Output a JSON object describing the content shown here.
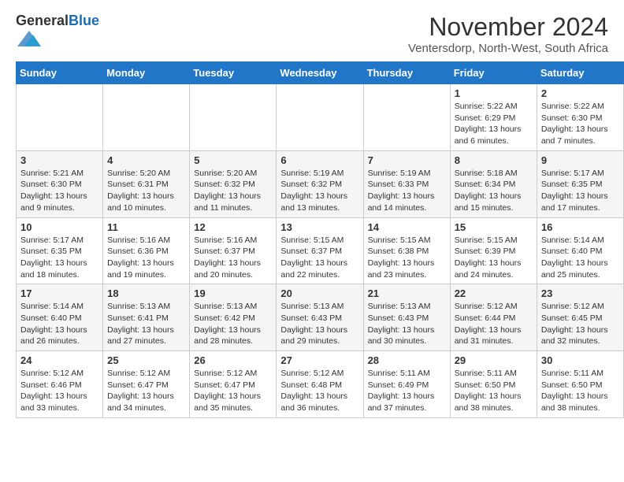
{
  "header": {
    "logo_general": "General",
    "logo_blue": "Blue",
    "title": "November 2024",
    "location": "Ventersdorp, North-West, South Africa"
  },
  "days_of_week": [
    "Sunday",
    "Monday",
    "Tuesday",
    "Wednesday",
    "Thursday",
    "Friday",
    "Saturday"
  ],
  "weeks": [
    [
      {
        "day": "",
        "info": ""
      },
      {
        "day": "",
        "info": ""
      },
      {
        "day": "",
        "info": ""
      },
      {
        "day": "",
        "info": ""
      },
      {
        "day": "",
        "info": ""
      },
      {
        "day": "1",
        "info": "Sunrise: 5:22 AM\nSunset: 6:29 PM\nDaylight: 13 hours and 6 minutes."
      },
      {
        "day": "2",
        "info": "Sunrise: 5:22 AM\nSunset: 6:30 PM\nDaylight: 13 hours and 7 minutes."
      }
    ],
    [
      {
        "day": "3",
        "info": "Sunrise: 5:21 AM\nSunset: 6:30 PM\nDaylight: 13 hours and 9 minutes."
      },
      {
        "day": "4",
        "info": "Sunrise: 5:20 AM\nSunset: 6:31 PM\nDaylight: 13 hours and 10 minutes."
      },
      {
        "day": "5",
        "info": "Sunrise: 5:20 AM\nSunset: 6:32 PM\nDaylight: 13 hours and 11 minutes."
      },
      {
        "day": "6",
        "info": "Sunrise: 5:19 AM\nSunset: 6:32 PM\nDaylight: 13 hours and 13 minutes."
      },
      {
        "day": "7",
        "info": "Sunrise: 5:19 AM\nSunset: 6:33 PM\nDaylight: 13 hours and 14 minutes."
      },
      {
        "day": "8",
        "info": "Sunrise: 5:18 AM\nSunset: 6:34 PM\nDaylight: 13 hours and 15 minutes."
      },
      {
        "day": "9",
        "info": "Sunrise: 5:17 AM\nSunset: 6:35 PM\nDaylight: 13 hours and 17 minutes."
      }
    ],
    [
      {
        "day": "10",
        "info": "Sunrise: 5:17 AM\nSunset: 6:35 PM\nDaylight: 13 hours and 18 minutes."
      },
      {
        "day": "11",
        "info": "Sunrise: 5:16 AM\nSunset: 6:36 PM\nDaylight: 13 hours and 19 minutes."
      },
      {
        "day": "12",
        "info": "Sunrise: 5:16 AM\nSunset: 6:37 PM\nDaylight: 13 hours and 20 minutes."
      },
      {
        "day": "13",
        "info": "Sunrise: 5:15 AM\nSunset: 6:37 PM\nDaylight: 13 hours and 22 minutes."
      },
      {
        "day": "14",
        "info": "Sunrise: 5:15 AM\nSunset: 6:38 PM\nDaylight: 13 hours and 23 minutes."
      },
      {
        "day": "15",
        "info": "Sunrise: 5:15 AM\nSunset: 6:39 PM\nDaylight: 13 hours and 24 minutes."
      },
      {
        "day": "16",
        "info": "Sunrise: 5:14 AM\nSunset: 6:40 PM\nDaylight: 13 hours and 25 minutes."
      }
    ],
    [
      {
        "day": "17",
        "info": "Sunrise: 5:14 AM\nSunset: 6:40 PM\nDaylight: 13 hours and 26 minutes."
      },
      {
        "day": "18",
        "info": "Sunrise: 5:13 AM\nSunset: 6:41 PM\nDaylight: 13 hours and 27 minutes."
      },
      {
        "day": "19",
        "info": "Sunrise: 5:13 AM\nSunset: 6:42 PM\nDaylight: 13 hours and 28 minutes."
      },
      {
        "day": "20",
        "info": "Sunrise: 5:13 AM\nSunset: 6:43 PM\nDaylight: 13 hours and 29 minutes."
      },
      {
        "day": "21",
        "info": "Sunrise: 5:13 AM\nSunset: 6:43 PM\nDaylight: 13 hours and 30 minutes."
      },
      {
        "day": "22",
        "info": "Sunrise: 5:12 AM\nSunset: 6:44 PM\nDaylight: 13 hours and 31 minutes."
      },
      {
        "day": "23",
        "info": "Sunrise: 5:12 AM\nSunset: 6:45 PM\nDaylight: 13 hours and 32 minutes."
      }
    ],
    [
      {
        "day": "24",
        "info": "Sunrise: 5:12 AM\nSunset: 6:46 PM\nDaylight: 13 hours and 33 minutes."
      },
      {
        "day": "25",
        "info": "Sunrise: 5:12 AM\nSunset: 6:47 PM\nDaylight: 13 hours and 34 minutes."
      },
      {
        "day": "26",
        "info": "Sunrise: 5:12 AM\nSunset: 6:47 PM\nDaylight: 13 hours and 35 minutes."
      },
      {
        "day": "27",
        "info": "Sunrise: 5:12 AM\nSunset: 6:48 PM\nDaylight: 13 hours and 36 minutes."
      },
      {
        "day": "28",
        "info": "Sunrise: 5:11 AM\nSunset: 6:49 PM\nDaylight: 13 hours and 37 minutes."
      },
      {
        "day": "29",
        "info": "Sunrise: 5:11 AM\nSunset: 6:50 PM\nDaylight: 13 hours and 38 minutes."
      },
      {
        "day": "30",
        "info": "Sunrise: 5:11 AM\nSunset: 6:50 PM\nDaylight: 13 hours and 38 minutes."
      }
    ]
  ]
}
